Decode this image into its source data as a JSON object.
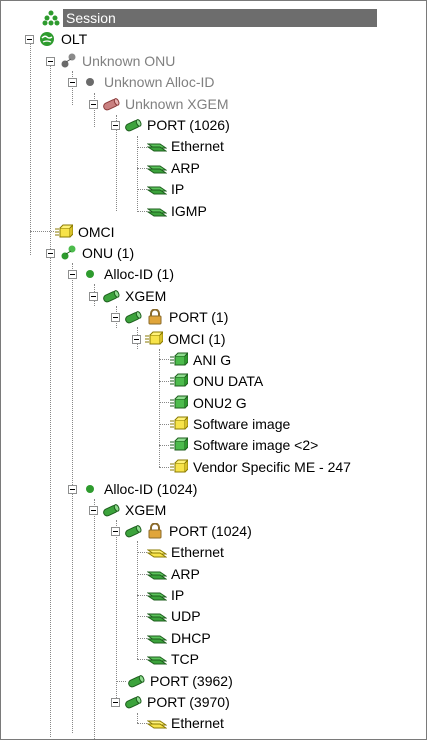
{
  "session": {
    "label": "Session"
  },
  "olt": {
    "label": "OLT"
  },
  "unknown": {
    "onu_label": "Unknown ONU",
    "alloc_label": "Unknown Alloc-ID",
    "xgem_label": "Unknown XGEM",
    "port_label": "PORT (1026)",
    "protocols": [
      "Ethernet",
      "ARP",
      "IP",
      "IGMP"
    ]
  },
  "omci_root": {
    "label": "OMCI"
  },
  "onu1": {
    "label": "ONU (1)",
    "alloc1": {
      "label": "Alloc-ID (1)",
      "xgem_label": "XGEM",
      "port_label": "PORT (1)",
      "omci_label": "OMCI (1)",
      "omci_children": [
        "ANI G",
        "ONU DATA",
        "ONU2 G",
        "Software image",
        "Software image <2>",
        "Vendor Specific ME - 247"
      ]
    },
    "alloc1024": {
      "label": "Alloc-ID (1024)",
      "xgem_label": "XGEM",
      "port1024_label": "PORT (1024)",
      "port1024_children": [
        "Ethernet",
        "ARP",
        "IP",
        "UDP",
        "DHCP",
        "TCP"
      ],
      "port3962_label": "PORT (3962)",
      "port3970_label": "PORT (3970)",
      "port3970_children": [
        "Ethernet"
      ]
    }
  },
  "icons": {
    "session": "session-tree-icon",
    "olt": "globe-icon",
    "onu": "onu-nodes-icon",
    "alloc": "dot-icon",
    "xgem": "pipe-icon",
    "port": "pipe-icon",
    "lock": "padlock-icon",
    "protocol": "stacked-layer-icon",
    "omci": "box-icon",
    "me": "managed-entity-icon"
  },
  "colors": {
    "session_bg": "#6d6d6d",
    "muted_text": "#808080",
    "green": "#2e9b2e"
  }
}
